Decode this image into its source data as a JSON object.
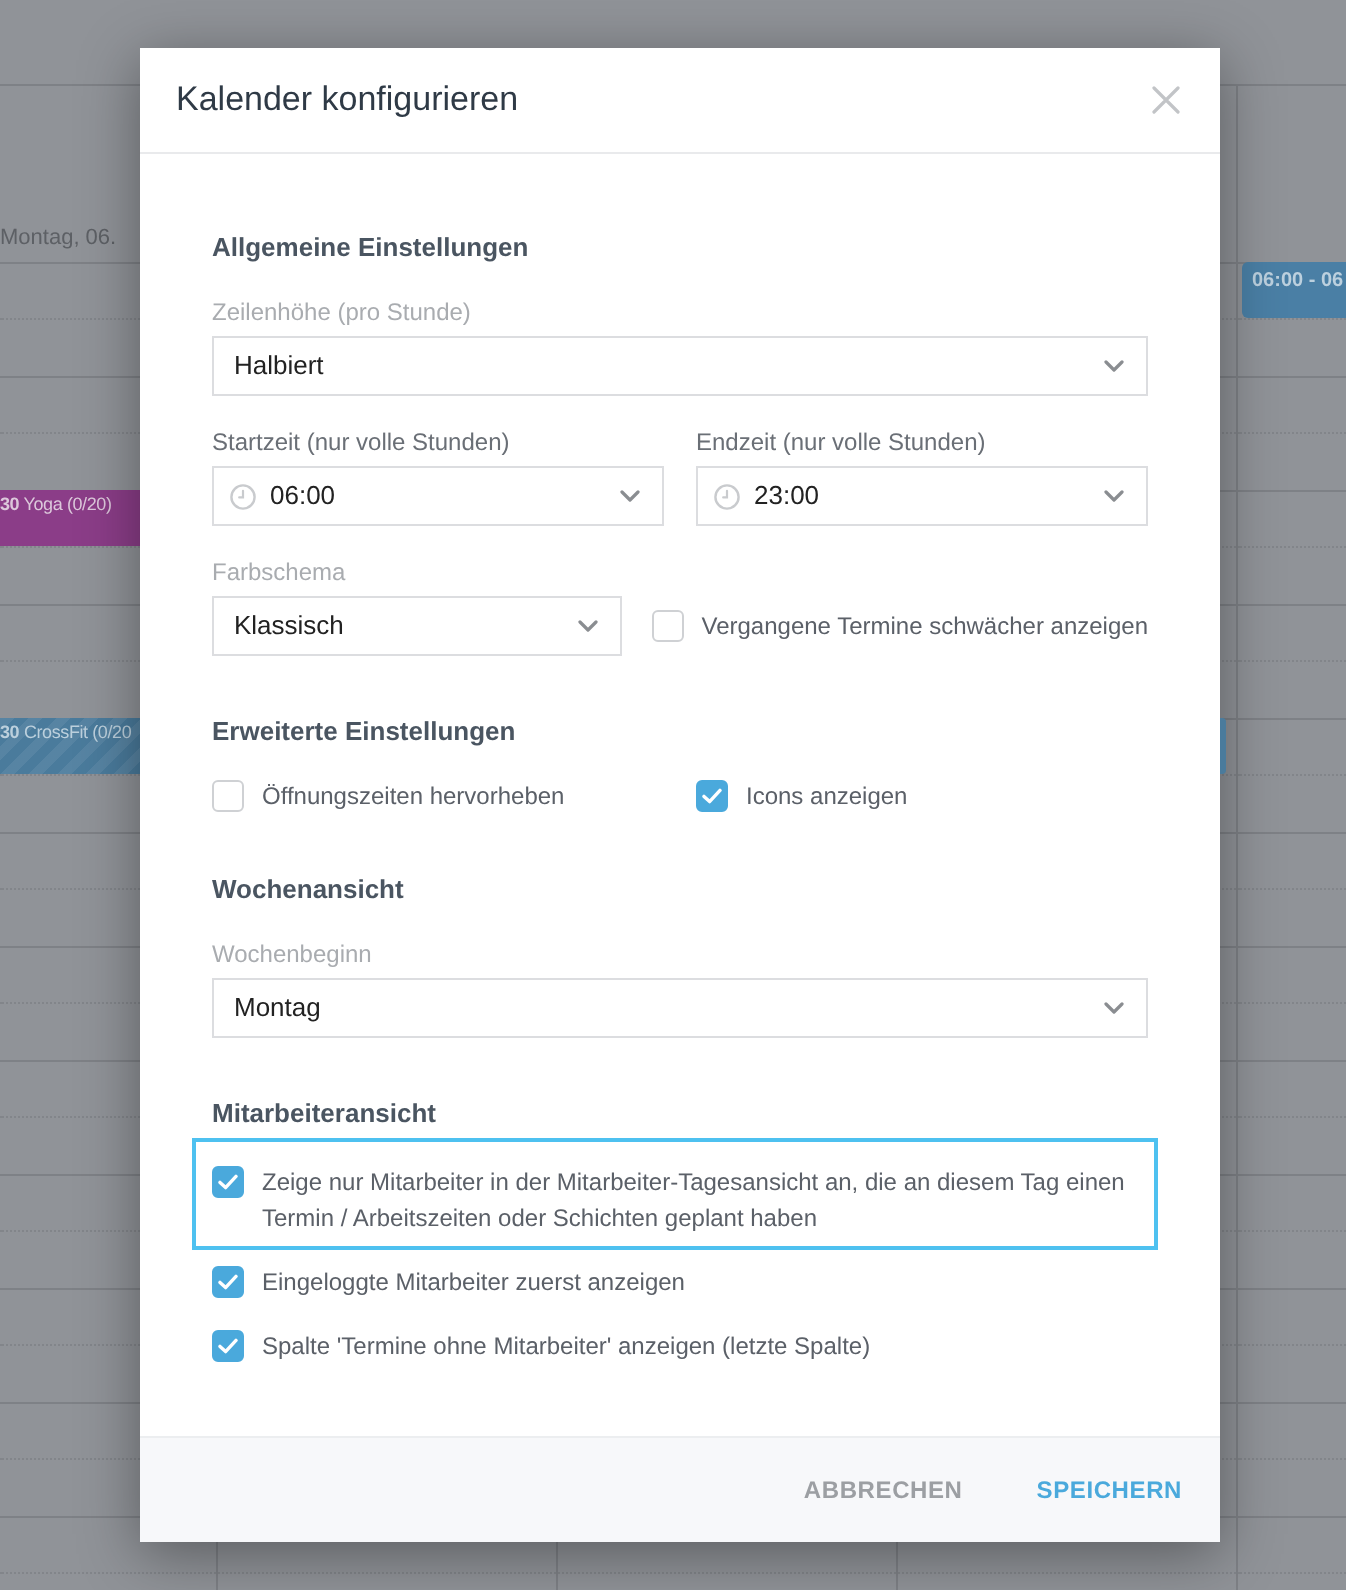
{
  "calendar": {
    "date_label": "Montag, 06.",
    "events": [
      {
        "time": "30",
        "title": "Yoga (0/20)",
        "color": "#8b3d88",
        "striped": false
      },
      {
        "time": "30",
        "title": "CrossFit (0/20",
        "color": "#4a7b9c",
        "striped": true
      },
      {
        "time": "06:00 - 06",
        "color": "#4a7fa5",
        "striped": false
      },
      {
        "color": "#4a7b9c"
      }
    ]
  },
  "dialog": {
    "title": "Kalender konfigurieren",
    "sections": [
      {
        "heading": "Allgemeine Einstellungen",
        "rows": [
          {
            "kind": "select",
            "label": "Zeilenhöhe (pro Stunde)",
            "dimmed": true,
            "value": "Halbiert"
          },
          {
            "kind": "columns",
            "fields": [
              {
                "kind": "time_select",
                "label": "Startzeit (nur volle Stunden)",
                "dimmed": false,
                "value": "06:00"
              },
              {
                "kind": "time_select",
                "label": "Endzeit (nur volle Stunden)",
                "dimmed": false,
                "value": "23:00"
              }
            ]
          },
          {
            "kind": "inline",
            "fields": [
              {
                "kind": "select",
                "label": "Farbschema",
                "dimmed": true,
                "value": "Klassisch"
              },
              {
                "kind": "checkbox",
                "label": "Vergangene Termine schwächer anzeigen",
                "checked": false
              }
            ]
          }
        ]
      },
      {
        "heading": "Erweiterte Einstellungen",
        "rows": [
          {
            "kind": "columns",
            "fields": [
              {
                "kind": "checkbox",
                "label": "Öffnungszeiten hervorheben",
                "checked": false
              },
              {
                "kind": "checkbox",
                "label": "Icons anzeigen",
                "checked": true
              }
            ]
          }
        ]
      },
      {
        "heading": "Wochenansicht",
        "rows": [
          {
            "kind": "select",
            "label": "Wochenbeginn",
            "dimmed": true,
            "value": "Montag"
          }
        ]
      },
      {
        "heading": "Mitarbeiteransicht",
        "rows": [
          {
            "kind": "checkbox",
            "label": "Zeige nur Mitarbeiter in der Mitarbeiter-Tagesansicht an, die an diesem Tag einen Termin / Arbeitszeiten oder Schichten geplant haben",
            "checked": true,
            "highlighted": true
          },
          {
            "kind": "checkbox",
            "label": "Eingeloggte Mitarbeiter zuerst anzeigen",
            "checked": true,
            "highlighted": false
          },
          {
            "kind": "checkbox",
            "label": "Spalte 'Termine ohne Mitarbeiter' anzeigen (letzte Spalte)",
            "checked": true,
            "highlighted": false
          }
        ]
      }
    ],
    "buttons": [
      {
        "label": "ABBRECHEN",
        "kind": "secondary"
      },
      {
        "label": "SPEICHERN",
        "kind": "primary"
      }
    ]
  }
}
